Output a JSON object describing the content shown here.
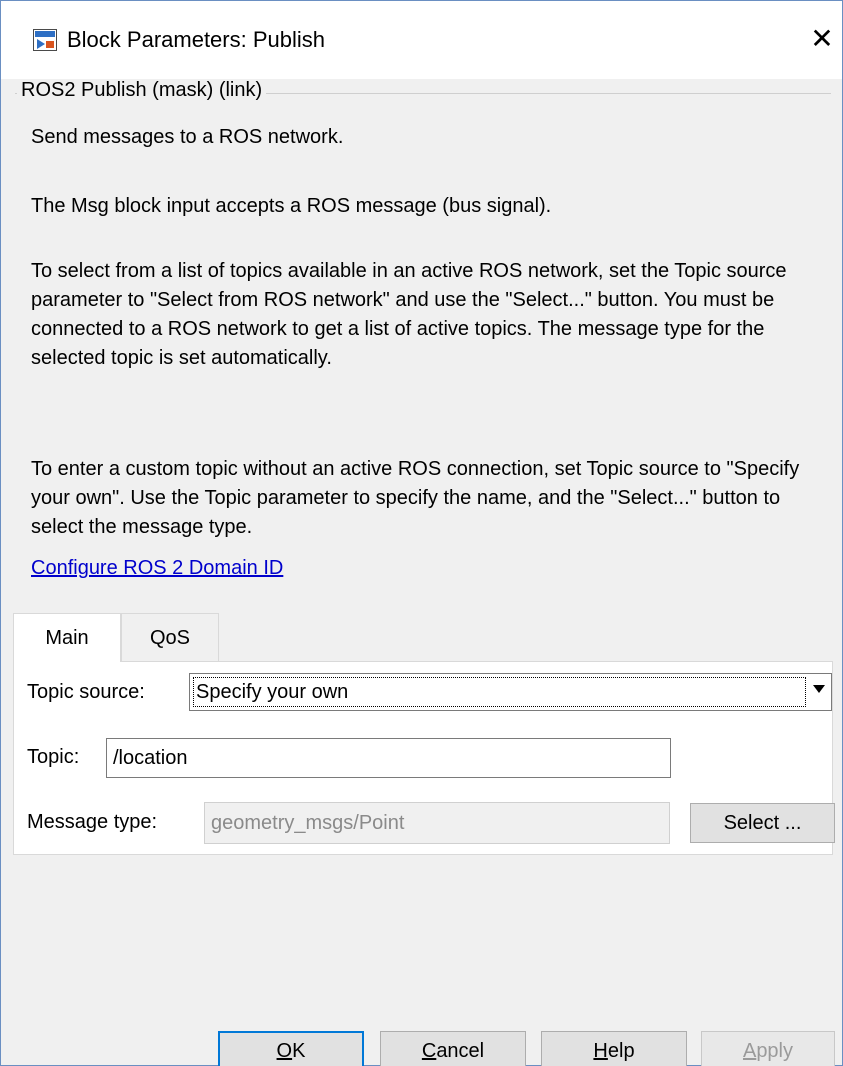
{
  "window": {
    "title": "Block Parameters: Publish",
    "close_glyph": "✕",
    "icon": "simulink-block-icon"
  },
  "mask": {
    "legend": "ROS2 Publish (mask) (link)",
    "paragraphs": [
      "Send messages to a ROS network.",
      "The Msg block input accepts a ROS message (bus signal).",
      "To select from a list of topics available in an active ROS network, set the Topic source parameter to \"Select from ROS network\" and use the \"Select...\" button. You must be connected to a ROS network to get a list of active topics. The message type for the selected topic is set automatically.",
      "To enter a custom topic without an active ROS connection, set Topic source to \"Specify your own\". Use the Topic parameter to specify the name, and the \"Select...\" button to select the message type."
    ],
    "link": "Configure ROS 2 Domain ID"
  },
  "tabs": [
    {
      "label": "Main",
      "active": true
    },
    {
      "label": "QoS",
      "active": false
    }
  ],
  "main": {
    "topic_source_label": "Topic source:",
    "topic_source_value": "Specify your own",
    "topic_label": "Topic:",
    "topic_value": "/location",
    "message_type_label": "Message type:",
    "message_type_value": "geometry_msgs/Point",
    "select_button": "Select ..."
  },
  "buttons": {
    "ok": {
      "mnemonic": "O",
      "rest": "K"
    },
    "cancel": {
      "mnemonic": "C",
      "rest": "ancel"
    },
    "help": {
      "mnemonic": "H",
      "rest": "elp"
    },
    "apply": {
      "mnemonic": "A",
      "rest": "pply"
    }
  },
  "colors": {
    "accent": "#0078d7",
    "link": "#0000cc",
    "window_bg": "#f0f0f0"
  }
}
